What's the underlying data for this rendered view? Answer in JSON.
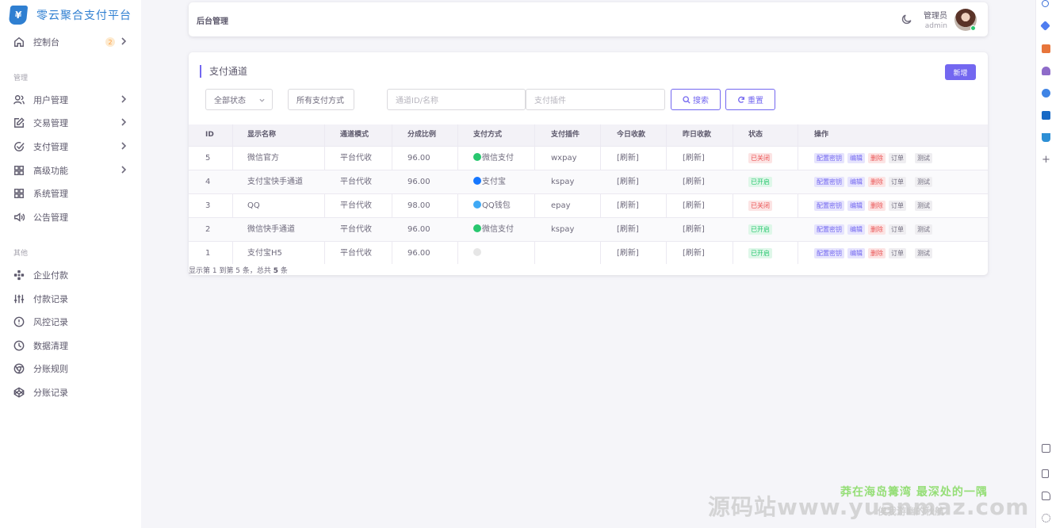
{
  "brand": {
    "logo_glyph": "¥",
    "name": "零云聚合支付平台"
  },
  "sidebar": {
    "dashboard": {
      "label": "控制台",
      "badge": "2",
      "icon": "home-icon"
    },
    "section_manage": "管理",
    "manage_items": [
      {
        "label": "用户管理",
        "icon": "users-icon",
        "has_children": true
      },
      {
        "label": "交易管理",
        "icon": "edit-icon",
        "has_children": true
      },
      {
        "label": "支付管理",
        "icon": "check-circle-icon",
        "has_children": true
      },
      {
        "label": "高级功能",
        "icon": "grid-icon",
        "has_children": true
      },
      {
        "label": "系统管理",
        "icon": "grid-icon",
        "has_children": false
      },
      {
        "label": "公告管理",
        "icon": "speaker-icon",
        "has_children": false
      }
    ],
    "section_other": "其他",
    "other_items": [
      {
        "label": "企业付款",
        "icon": "pinwheel-icon"
      },
      {
        "label": "付款记录",
        "icon": "sliders-icon"
      },
      {
        "label": "风控记录",
        "icon": "alert-circle-icon"
      },
      {
        "label": "数据清理",
        "icon": "clock-icon"
      },
      {
        "label": "分账规则",
        "icon": "chrome-icon"
      },
      {
        "label": "分账记录",
        "icon": "codepen-icon"
      }
    ]
  },
  "navbar": {
    "title": "后台管理",
    "role": "管理员",
    "username": "admin"
  },
  "card": {
    "title": "支付通道",
    "add_label": "新增",
    "filters": {
      "status": "全部状态",
      "pay_type": "所有支付方式",
      "channel_placeholder": "通道ID/名称",
      "plugin_placeholder": "支付插件",
      "search_label": "搜索",
      "reset_label": "重置"
    },
    "columns": [
      "ID",
      "显示名称",
      "通道模式",
      "分成比例",
      "支付方式",
      "支付插件",
      "今日收款",
      "昨日收款",
      "状态",
      "操作"
    ],
    "rows": [
      {
        "id": "5",
        "name": "微信官方",
        "mode": "平台代收",
        "rate": "96.00",
        "pay": "微信支付",
        "pay_color": "#28c76f",
        "plugin": "wxpay",
        "today": "[刷新]",
        "yesterday": "[刷新]",
        "status": "已关闭",
        "status_on": false
      },
      {
        "id": "4",
        "name": "支付宝快手通道",
        "mode": "平台代收",
        "rate": "96.00",
        "pay": "支付宝",
        "pay_color": "#1677ff",
        "plugin": "kspay",
        "today": "[刷新]",
        "yesterday": "[刷新]",
        "status": "已开启",
        "status_on": true
      },
      {
        "id": "3",
        "name": "QQ",
        "mode": "平台代收",
        "rate": "98.00",
        "pay": "QQ钱包",
        "pay_color": "#3fa9f5",
        "plugin": "epay",
        "today": "[刷新]",
        "yesterday": "[刷新]",
        "status": "已关闭",
        "status_on": false
      },
      {
        "id": "2",
        "name": "微信快手通道",
        "mode": "平台代收",
        "rate": "96.00",
        "pay": "微信支付",
        "pay_color": "#28c76f",
        "plugin": "kspay",
        "today": "[刷新]",
        "yesterday": "[刷新]",
        "status": "已开启",
        "status_on": true
      },
      {
        "id": "1",
        "name": "支付宝H5",
        "mode": "平台代收",
        "rate": "96.00",
        "pay": "",
        "pay_color": "#e6e6e6",
        "plugin": "",
        "today": "[刷新]",
        "yesterday": "[刷新]",
        "status": "已开启",
        "status_on": true
      }
    ],
    "ops": {
      "key": "配置密钥",
      "edit": "编辑",
      "del": "删除",
      "order": "订单",
      "test": "测试"
    },
    "summary_prefix": "显示第 1 到第 5 条，总共 ",
    "summary_total": "5",
    "summary_suffix": " 条"
  },
  "watermark": {
    "line1": "莽在海岛篝湾 最深处的一隅",
    "line2": "源码站www.yuanmaz.com",
    "line3": "俟我游幽的秋航"
  },
  "colors": {
    "primary": "#7367f0",
    "danger": "#ea5455",
    "success": "#28c76f",
    "brand": "#2f7fd1"
  }
}
